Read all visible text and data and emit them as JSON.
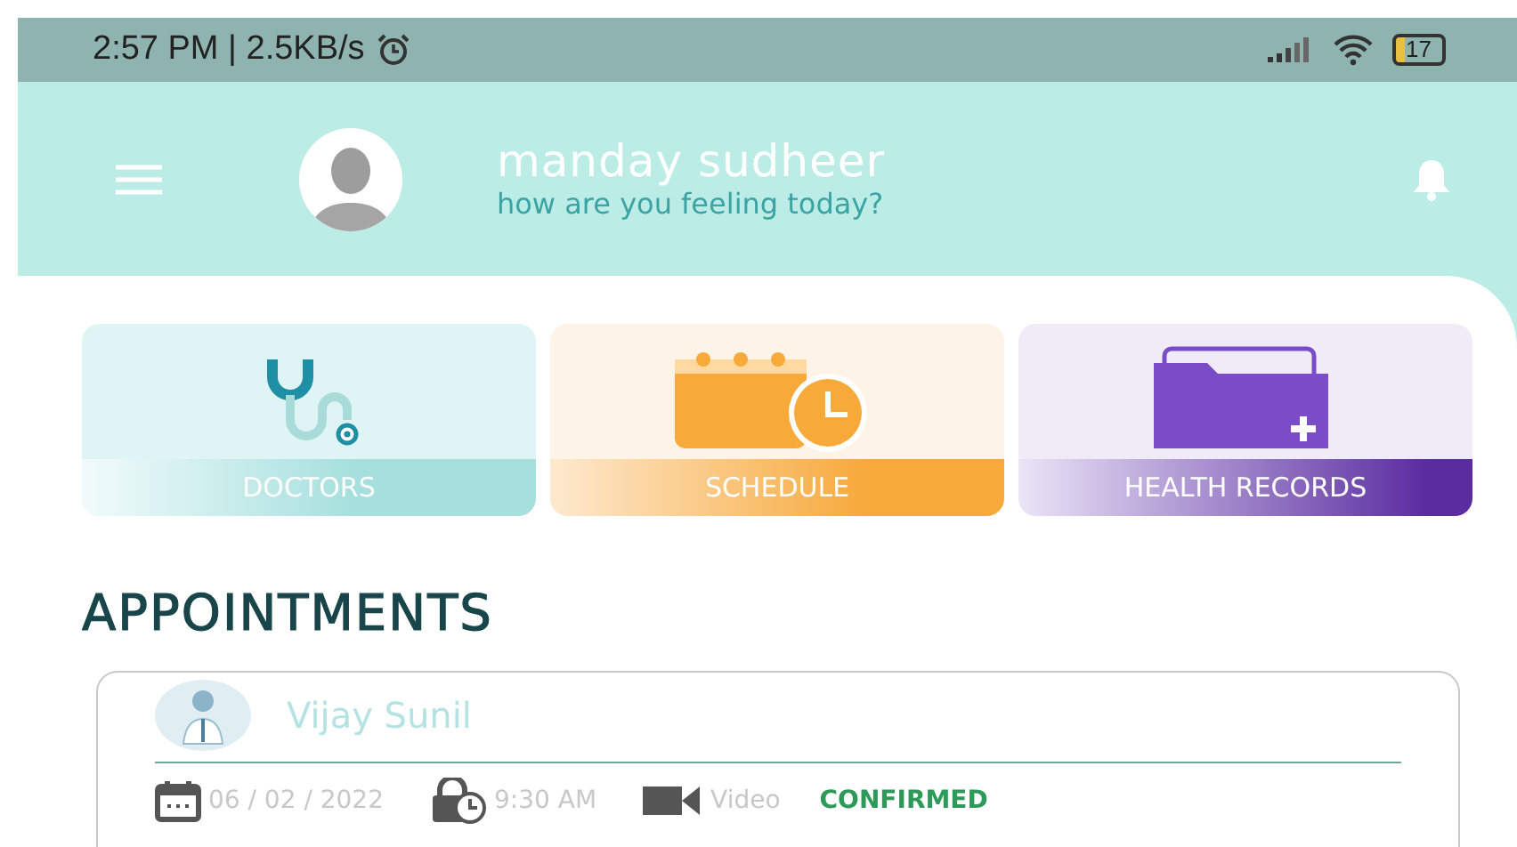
{
  "status_bar": {
    "time_speed": "2:57 PM | 2.5KB/s",
    "battery": "17"
  },
  "header": {
    "name": "manday sudheer",
    "greeting": "how are you feeling today?"
  },
  "tiles": [
    {
      "label": "DOCTORS",
      "kind": "doctors"
    },
    {
      "label": "SCHEDULE",
      "kind": "schedule"
    },
    {
      "label": "HEALTH RECORDS",
      "kind": "records"
    }
  ],
  "section_title": "APPOINTMENTS",
  "appointments": [
    {
      "doctor": "Vijay Sunil",
      "date": "06 / 02 / 2022",
      "time": "9:30 AM",
      "mode": "Video",
      "status": "CONFIRMED"
    }
  ]
}
